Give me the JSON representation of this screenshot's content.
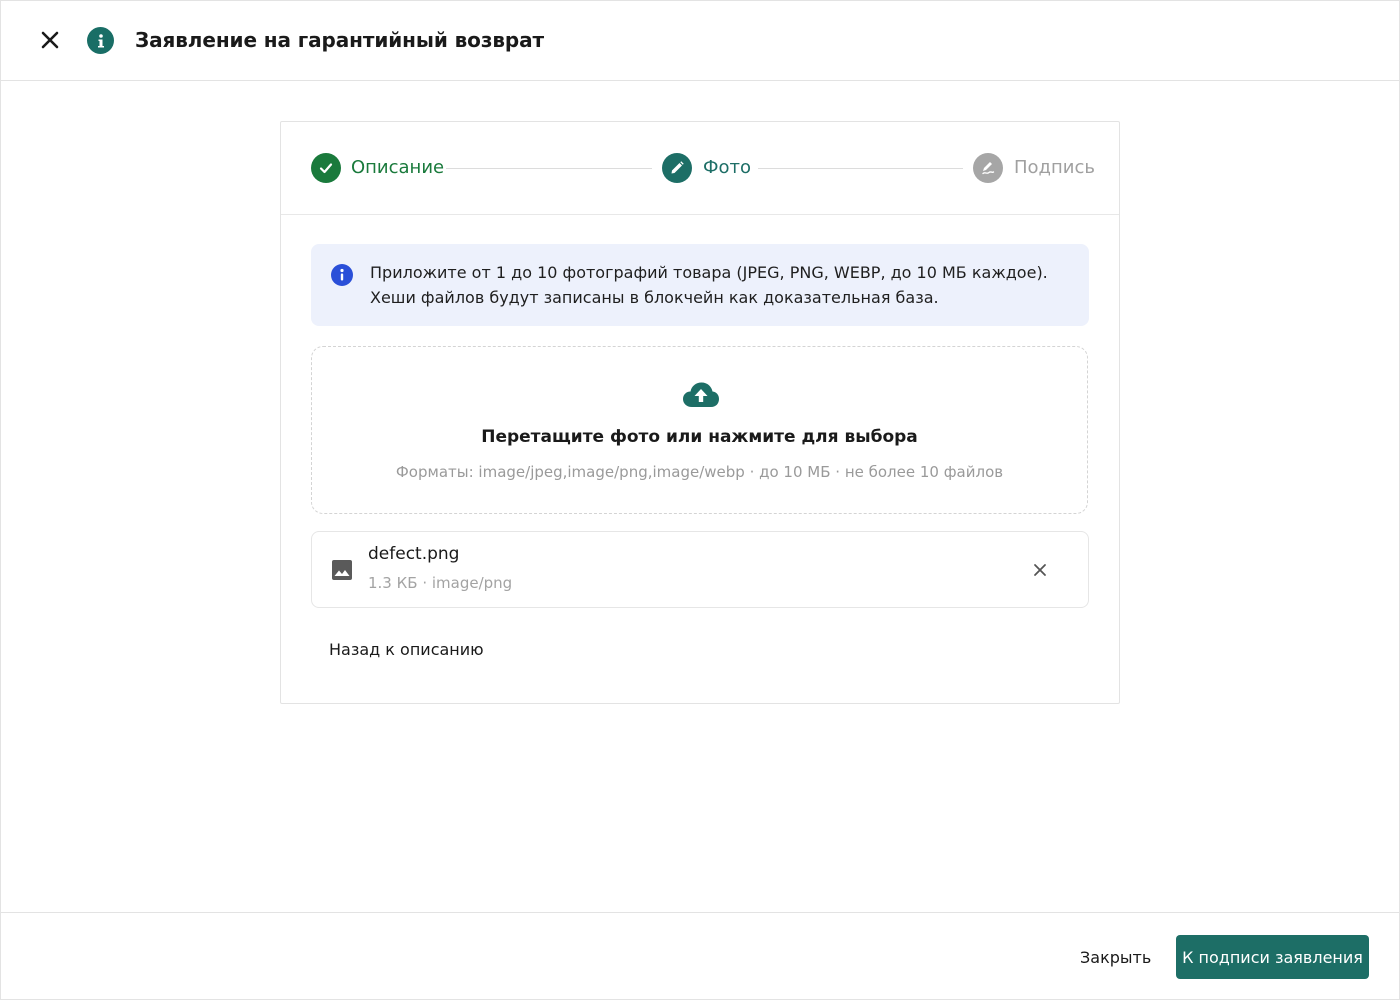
{
  "header": {
    "title": "Заявление на гарантийный возврат",
    "close_icon": "close-icon",
    "info_icon": "info-icon"
  },
  "stepper": {
    "steps": [
      {
        "label": "Описание",
        "state": "completed",
        "icon": "check-icon"
      },
      {
        "label": "Фото",
        "state": "active",
        "icon": "pencil-icon"
      },
      {
        "label": "Подпись",
        "state": "pending",
        "icon": "signature-icon"
      }
    ]
  },
  "alert": {
    "text": "Приложите от 1 до 10 фотографий товара (JPEG, PNG, WEBP, до 10 МБ каждое). Хеши файлов будут записаны в блокчейн как доказательная база.",
    "icon": "info-icon"
  },
  "dropzone": {
    "title": "Перетащите фото или нажмите для выбора",
    "hint": "Форматы: image/jpeg,image/png,image/webp · до 10 МБ · не более 10 файлов",
    "icon": "cloud-upload-icon"
  },
  "files": [
    {
      "name": "defect.png",
      "meta": "1.3 КБ · image/png",
      "icon": "image-icon"
    }
  ],
  "back_link": "Назад к описанию",
  "footer": {
    "close_label": "Закрыть",
    "primary_label": "К подписи заявления"
  },
  "colors": {
    "accent": "#1d6e66",
    "completed_green": "#1a7a3c",
    "pending_gray": "#a6a6a6",
    "alert_bg": "#edf1fc",
    "alert_icon": "#2a4fd8"
  }
}
